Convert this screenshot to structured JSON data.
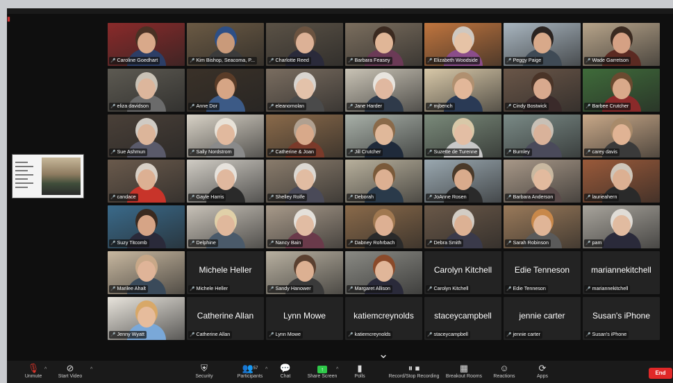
{
  "toolbar": {
    "mute_label": "Unmute",
    "video_label": "Start Video",
    "security_label": "Security",
    "participants_label": "Participants",
    "participants_count": "57",
    "chat_label": "Chat",
    "share_label": "Share Screen",
    "polls_label": "Polls",
    "record_label": "Record/Stop Recording",
    "breakout_label": "Breakout Rooms",
    "reactions_label": "Reactions",
    "apps_label": "Apps",
    "end_label": "End"
  },
  "participants": [
    {
      "name": "Caroline Goedhart",
      "bg": "#8a2a2a",
      "skin": "#d9a98a",
      "hair": "#4a3124",
      "shirt": "#2c3e66",
      "video": true
    },
    {
      "name": "Kim Bishop, Seacoma, P...",
      "bg": "#6b5a44",
      "skin": "#c99a7a",
      "hair": "#2d4f86",
      "shirt": "#3b3b3b",
      "video": true
    },
    {
      "name": "Charlotte Reed",
      "bg": "#5b5246",
      "skin": "#dcb196",
      "hair": "#6b5340",
      "shirt": "#2a2a3a",
      "video": true
    },
    {
      "name": "Barbara Feasey",
      "bg": "#7b6e5e",
      "skin": "#e0b697",
      "hair": "#3b2a20",
      "shirt": "#6b3a56",
      "video": true
    },
    {
      "name": "Elizabeth Woodside",
      "bg": "#c0753e",
      "skin": "#e6c3a6",
      "hair": "#cfc8c0",
      "shirt": "#8b4d8a",
      "video": true
    },
    {
      "name": "Peggy Paige",
      "bg": "#a9b6c0",
      "skin": "#d8a98a",
      "hair": "#2a2320",
      "shirt": "#3f4a55",
      "video": true
    },
    {
      "name": "Wade Garretson",
      "bg": "#b7a48a",
      "skin": "#d5a184",
      "hair": "#3a2a20",
      "shirt": "#5b2a22",
      "video": true
    },
    {
      "name": "eliza davidson",
      "bg": "#5d5a52",
      "skin": "#dcb69c",
      "hair": "#c9c2b6",
      "shirt": "#6b6b6b",
      "video": true
    },
    {
      "name": "Anne Dor",
      "bg": "#3a3128",
      "skin": "#d6a585",
      "hair": "#5a3c28",
      "shirt": "#3c5a86",
      "video": true
    },
    {
      "name": "eleanornolan",
      "bg": "#7a6d60",
      "skin": "#e3c2aa",
      "hair": "#d8d4cf",
      "shirt": "#4a4a4a",
      "video": true
    },
    {
      "name": "Jane Harder",
      "bg": "#c9c3b5",
      "skin": "#e0b8a0",
      "hair": "#e8e4de",
      "shirt": "#2f3a4a",
      "video": true
    },
    {
      "name": "mjbench",
      "bg": "#d8c8a8",
      "skin": "#e2b799",
      "hair": "#b09070",
      "shirt": "#2a3a55",
      "video": true
    },
    {
      "name": "Cindy Bostwick",
      "bg": "#6a5648",
      "skin": "#d8a98e",
      "hair": "#4a3428",
      "shirt": "#3a2a2a",
      "video": true
    },
    {
      "name": "Barbee Crutcher",
      "bg": "#3f6b3a",
      "skin": "#d9a98a",
      "hair": "#6b4a30",
      "shirt": "#8a2a2a",
      "video": true
    },
    {
      "name": "Sue Ashmun",
      "bg": "#4a4038",
      "skin": "#dcb59a",
      "hair": "#d0cbc4",
      "shirt": "#5a5a6a",
      "video": true
    },
    {
      "name": "Sally Nordstrom",
      "bg": "#d8d2c6",
      "skin": "#e1b99e",
      "hair": "#e8e2d8",
      "shirt": "#8a8a8a",
      "video": true
    },
    {
      "name": "Catherine & Joan",
      "bg": "#8a6a4a",
      "skin": "#d8a98a",
      "hair": "#b0a090",
      "shirt": "#7a3a2a",
      "video": true
    },
    {
      "name": "Jill Crutcher",
      "bg": "#a8b0a8",
      "skin": "#e0b89a",
      "hair": "#8a6a4a",
      "shirt": "#1f2a3a",
      "video": true
    },
    {
      "name": "Suzette de Turenne",
      "bg": "#7a8a7a",
      "skin": "#e3bea4",
      "hair": "#d8c8a8",
      "shirt": "#c8c8c8",
      "video": true
    },
    {
      "name": "Burnley",
      "bg": "#7a8a86",
      "skin": "#d9b29a",
      "hair": "#c8c0b6",
      "shirt": "#4a4a5a",
      "video": true
    },
    {
      "name": "carey davis",
      "bg": "#c8a888",
      "skin": "#e0b394",
      "hair": "#a88a6a",
      "shirt": "#3a3a3a",
      "video": true
    },
    {
      "name": "candace",
      "bg": "#6a5a4c",
      "skin": "#dcb093",
      "hair": "#d8d0c6",
      "shirt": "#c8342a",
      "video": true
    },
    {
      "name": "Gayle Harris",
      "bg": "#d0ccc4",
      "skin": "#e0b89e",
      "hair": "#e6e2dc",
      "shirt": "#2a2a2a",
      "video": true
    },
    {
      "name": "Shelley Rolfe",
      "bg": "#8a7c6c",
      "skin": "#e1bca2",
      "hair": "#dcd8d2",
      "shirt": "#4a4a58",
      "video": true
    },
    {
      "name": "Deborah",
      "bg": "#b8b09c",
      "skin": "#dcb092",
      "hair": "#7a5a3a",
      "shirt": "#2a3a4a",
      "video": true
    },
    {
      "name": "JoAnne Rosen",
      "bg": "#9aa8b0",
      "skin": "#d9ab8c",
      "hair": "#4a3a2a",
      "shirt": "#2a2a2a",
      "video": true
    },
    {
      "name": "Barbara Anderson",
      "bg": "#a89888",
      "skin": "#e2ba9e",
      "hair": "#c8b8a0",
      "shirt": "#5a4a4a",
      "video": true
    },
    {
      "name": "laurieahern",
      "bg": "#9a5a3a",
      "skin": "#dcb092",
      "hair": "#cfc6ba",
      "shirt": "#2a2a2a",
      "video": true
    },
    {
      "name": "Suzy Titcomb",
      "bg": "#3a6a8a",
      "skin": "#d6a486",
      "hair": "#3a2a20",
      "shirt": "#2a2a3a",
      "video": true
    },
    {
      "name": "Delphine",
      "bg": "#c8c2b8",
      "skin": "#e0b89c",
      "hair": "#e0d0a8",
      "shirt": "#4a5a6a",
      "video": true
    },
    {
      "name": "Nancy Bain",
      "bg": "#a89a8a",
      "skin": "#e1bca3",
      "hair": "#e4e0da",
      "shirt": "#6a3a4a",
      "video": true
    },
    {
      "name": "Dabney Rohrbach",
      "bg": "#8a6a4a",
      "skin": "#ddb093",
      "hair": "#a07850",
      "shirt": "#2a2a2a",
      "video": true
    },
    {
      "name": "Debra Smith",
      "bg": "#6a5848",
      "skin": "#dcb194",
      "hair": "#d2ccc4",
      "shirt": "#3a3a4a",
      "video": true
    },
    {
      "name": "Sarah Robinson",
      "bg": "#9a7a5a",
      "skin": "#e0b597",
      "hair": "#c8884a",
      "shirt": "#5a5a5a",
      "video": true
    },
    {
      "name": "pam",
      "bg": "#a8a49c",
      "skin": "#e1bba0",
      "hair": "#e0dcd6",
      "shirt": "#2a2a3a",
      "video": true
    },
    {
      "name": "Marilee Ahalt",
      "bg": "#c8b8a0",
      "skin": "#dfb498",
      "hair": "#c8a888",
      "shirt": "#3a4a5a",
      "video": true
    },
    {
      "name": "Michele Heller",
      "video": false
    },
    {
      "name": "Sandy Hanower",
      "bg": "#b8b0a0",
      "skin": "#dcb092",
      "hair": "#5a4030",
      "shirt": "#3a3a3a",
      "video": true
    },
    {
      "name": "Margaret Allison",
      "bg": "#8a8a84",
      "skin": "#e0b699",
      "hair": "#8a4a2a",
      "shirt": "#2a2a3a",
      "video": true
    },
    {
      "name": "Carolyn Kitchell",
      "video": false
    },
    {
      "name": "Edie Tenneson",
      "video": false
    },
    {
      "name": "mariannekitchell",
      "video": false
    },
    {
      "name": "Jenny Wyatt",
      "bg": "#e8e4dc",
      "skin": "#e6bc9c",
      "hair": "#d8a868",
      "shirt": "#7aa8d8",
      "video": true
    },
    {
      "name": "Catherine Allan",
      "video": false
    },
    {
      "name": "Lynn Mowe",
      "video": false
    },
    {
      "name": "katiemcreynolds",
      "video": false
    },
    {
      "name": "staceycampbell",
      "video": false
    },
    {
      "name": "jennie carter",
      "video": false
    },
    {
      "name": "Susan's iPhone",
      "video": false
    }
  ]
}
